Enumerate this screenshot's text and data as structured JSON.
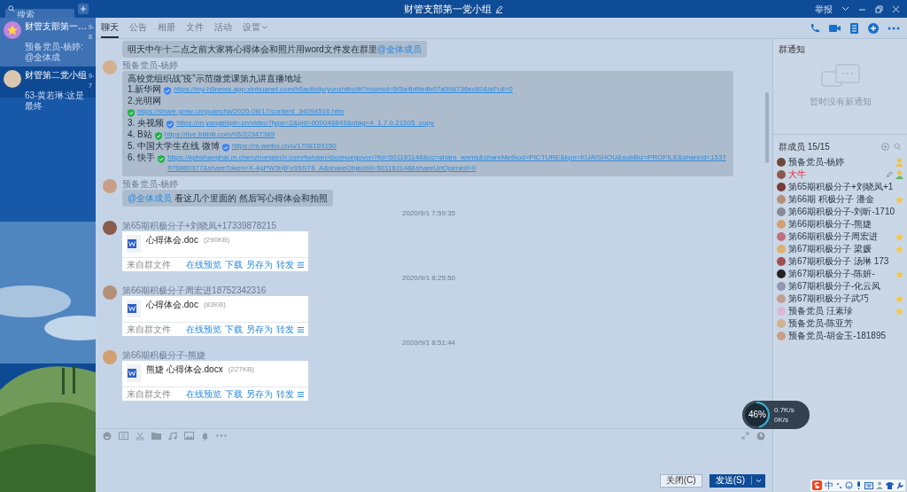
{
  "window": {
    "title": "财管支部第一党小组",
    "report": "举报"
  },
  "search": {
    "placeholder": "搜索"
  },
  "conversations": [
    {
      "name": "财管支部第一…",
      "time": "9-8",
      "preview": "预备党员-杨婷:@全体成",
      "selected": true
    },
    {
      "name": "财管第二党小组",
      "time": "9-7",
      "preview": "63-黄若琳:这是最终",
      "selected": false
    }
  ],
  "tabs": [
    {
      "label": "聊天",
      "selected": true,
      "dropdown": false
    },
    {
      "label": "公告",
      "selected": false,
      "dropdown": false
    },
    {
      "label": "相册",
      "selected": false,
      "dropdown": false
    },
    {
      "label": "文件",
      "selected": false,
      "dropdown": false
    },
    {
      "label": "活动",
      "selected": false,
      "dropdown": false
    },
    {
      "label": "设置",
      "selected": false,
      "dropdown": true
    }
  ],
  "messages": [
    {
      "kind": "text",
      "parts": [
        {
          "kind": "plain",
          "text": "明天中午十二点之前大家将心得体会和照片用word文件发在群里"
        },
        {
          "kind": "mention",
          "text": "@全体成员"
        }
      ]
    },
    {
      "kind": "links",
      "sender": "预备党员-杨婷",
      "lines": [
        {
          "kind": "plain",
          "text": "高校党组织战“疫”示范微党课第九讲直播地址"
        },
        {
          "kind": "link",
          "label": "1.新华网",
          "color": "#3b82f6",
          "url": "https://my-h5news.app.xinhuanet.com/h5activity/yunzhibo/#/?roomId=5f3a4bf9e4b07a598736ec80&isFull=0"
        },
        {
          "kind": "plain",
          "text": "2.光明网"
        },
        {
          "kind": "link",
          "color": "#22b04b",
          "url": "https://share.gmw.cn/guancha/2020-08/17/content_34094516.htm"
        },
        {
          "kind": "link",
          "label": "3. 央视频",
          "color": "#3b82f6",
          "url": "https://m.yangshipin.cn/video?type=2&pid=600046849&ptag=4_1.7.0.21505_copy"
        },
        {
          "kind": "link",
          "label": "4. B站",
          "color": "#22b04b",
          "url": "https://live.bilibili.com/h5/22347389"
        },
        {
          "kind": "link",
          "label": "5. 中国大学生在线 微博",
          "color": "#3b82f6",
          "url": "https://m.weibo.cn/u/1708159150"
        },
        {
          "kind": "link",
          "label": "6. 快手",
          "color": "#22b04b",
          "url": "https://kphshanghai.m.chenzhongtech.com/fw/user/dxomoegovcn?fid=501161148&cc=share_wxms&shareMethod=PICTURE&kpn=KUAISHOU&subBiz=PROFILE&shareId=1537976860377&shareToken=X-4gPW3HjFx9SST6_A&shareObjectId=501161148&shareUrlOpened=0"
        }
      ]
    },
    {
      "kind": "text",
      "sender": "预备党员-杨婷",
      "parts": [
        {
          "kind": "mention",
          "text": "@全体成员"
        },
        {
          "kind": "plain",
          "text": " 看这几个里面的 然后写心得体会和拍照"
        }
      ]
    },
    {
      "kind": "time",
      "text": "2020/9/1 7:59:35"
    },
    {
      "kind": "file",
      "sender": "第65期积极分子+刘晓凤+17339878215",
      "file_name": "心得体会.doc",
      "size": "(290KB)",
      "source": "来自群文件",
      "actions": [
        "在线预览",
        "下载",
        "另存为",
        "转发"
      ]
    },
    {
      "kind": "time",
      "text": "2020/9/1 8:25:50"
    },
    {
      "kind": "file",
      "sender": "第66期积极分子周宏进18752342316",
      "file_name": "心得体会.doc",
      "size": "(83KB)",
      "source": "来自群文件",
      "actions": [
        "在线预览",
        "下载",
        "另存为",
        "转发"
      ]
    },
    {
      "kind": "time",
      "text": "2020/9/1 8:51:44"
    },
    {
      "kind": "file",
      "sender": "第66期积极分子-熊婕",
      "file_name": "熊婕 心得体会.docx",
      "size": "(227KB)",
      "source": "来自群文件",
      "actions": [
        "在线预览",
        "下载",
        "另存为",
        "转发"
      ]
    }
  ],
  "composer": {
    "close": "关闭(C)",
    "send": "发送(S)"
  },
  "notice": {
    "title": "群通知",
    "empty_text": "暂时没有新通知"
  },
  "members": {
    "title": "群成员 15/15",
    "list": [
      {
        "name": "预备党员-杨婷",
        "owner": true,
        "admin": false,
        "star": false,
        "highlighted": false,
        "editable": false
      },
      {
        "name": "大牛",
        "owner": false,
        "admin": true,
        "star": false,
        "highlighted": true,
        "editable": true
      },
      {
        "name": "第65期积极分子+刘晓凤+1",
        "owner": false,
        "admin": false,
        "star": false,
        "highlighted": false,
        "editable": false
      },
      {
        "name": "第66期 积极分子 潘金",
        "owner": false,
        "admin": false,
        "star": true,
        "highlighted": false,
        "editable": false
      },
      {
        "name": "第66期积极分子-刘昕-1710",
        "owner": false,
        "admin": false,
        "star": false,
        "highlighted": false,
        "editable": false
      },
      {
        "name": "第66期积极分子-熊婕",
        "owner": false,
        "admin": false,
        "star": false,
        "highlighted": false,
        "editable": false
      },
      {
        "name": "第66期积极分子周宏进",
        "owner": false,
        "admin": false,
        "star": true,
        "highlighted": false,
        "editable": false
      },
      {
        "name": "第67期积极分子 梁媛",
        "owner": false,
        "admin": false,
        "star": true,
        "highlighted": false,
        "editable": false
      },
      {
        "name": "第67期积极分子 汤琳 173",
        "owner": false,
        "admin": false,
        "star": false,
        "highlighted": false,
        "editable": false
      },
      {
        "name": "第67期积极分子-陈妍-",
        "owner": false,
        "admin": false,
        "star": true,
        "highlighted": false,
        "editable": false
      },
      {
        "name": "第67期积极分子-化云凤",
        "owner": false,
        "admin": false,
        "star": false,
        "highlighted": false,
        "editable": false
      },
      {
        "name": "第67期积极分子武巧",
        "owner": false,
        "admin": false,
        "star": true,
        "highlighted": false,
        "editable": false
      },
      {
        "name": "预备党员 汪素珍",
        "owner": false,
        "admin": false,
        "star": true,
        "highlighted": false,
        "editable": false
      },
      {
        "name": "预备党员-陈亚芳",
        "owner": false,
        "admin": false,
        "star": false,
        "highlighted": false,
        "editable": false
      },
      {
        "name": "预备党员-胡金玉-181895",
        "owner": false,
        "admin": false,
        "star": false,
        "highlighted": false,
        "editable": false
      }
    ]
  },
  "monitor": {
    "percent": "46%",
    "level": 0.46,
    "upload": "0.7K/s",
    "download": "0K/s"
  },
  "ime": {
    "label": "中"
  }
}
